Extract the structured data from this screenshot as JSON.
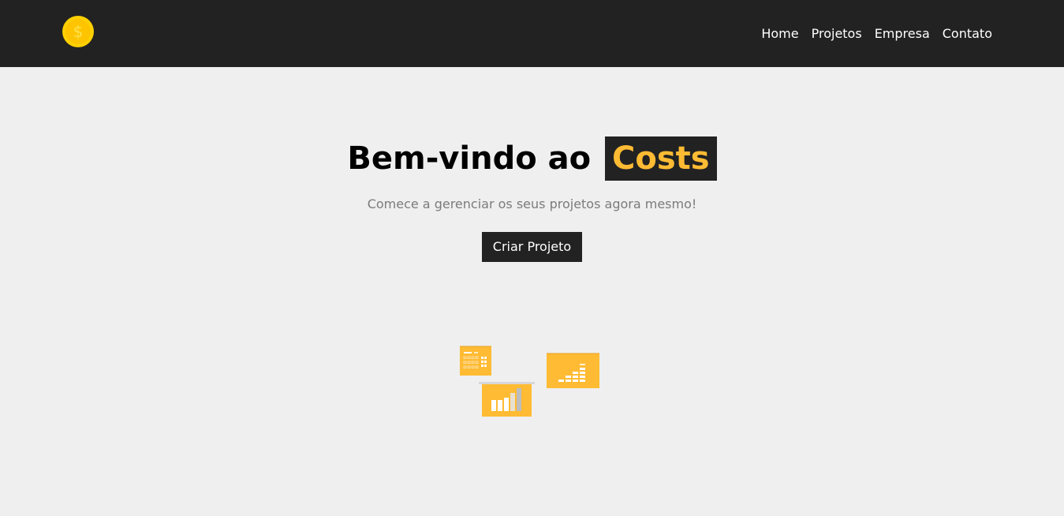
{
  "header": {
    "logo_icon": "dollar-coin-icon",
    "nav_items": [
      {
        "label": "Home"
      },
      {
        "label": "Projetos"
      },
      {
        "label": "Empresa"
      },
      {
        "label": "Contato"
      }
    ]
  },
  "hero": {
    "title_prefix": "Bem-vindo ao",
    "title_brand": "Costs",
    "subtitle": "Comece a gerenciar os seus projetos agora mesmo!",
    "cta_label": "Criar Projeto",
    "illustration_icon": "savings-charts-illustration"
  },
  "colors": {
    "navbar_bg": "#222222",
    "accent": "#ffbb33",
    "page_bg": "#efefef",
    "subtitle_text": "#7b7b7b",
    "coin": "#ffd700"
  }
}
